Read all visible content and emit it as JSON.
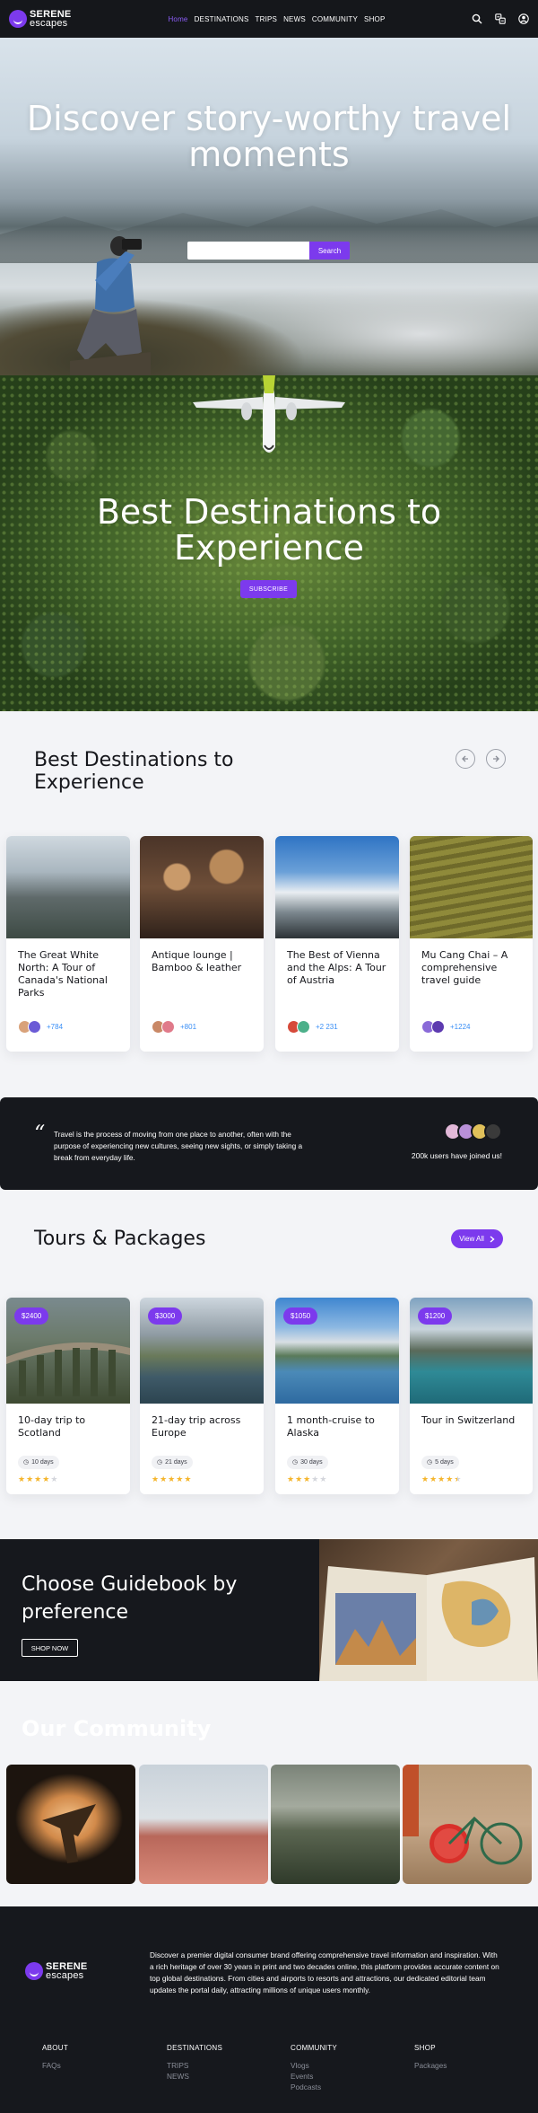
{
  "brand": {
    "name_line1": "SERENE",
    "name_line2": "escapes"
  },
  "nav": {
    "items": [
      "Home",
      "DESTINATIONS",
      "TRIPS",
      "NEWS",
      "COMMUNITY",
      "SHOP"
    ],
    "active": "Home",
    "icons": [
      "search-icon",
      "translate-icon",
      "user-icon"
    ]
  },
  "hero": {
    "title": "Discover story-worthy travel moments",
    "search_placeholder": "",
    "search_button": "Search"
  },
  "banner": {
    "title": "Best Destinations to Experience",
    "subscribe_button": "SUBSCRIBE"
  },
  "destinations": {
    "title": "Best Destinations to Experience",
    "cards": [
      {
        "title": "The Great White North: A Tour of Canada's National Parks",
        "count": "+784"
      },
      {
        "title": "Antique lounge | Bamboo & leather",
        "count": "+801"
      },
      {
        "title": "The Best of Vienna and the Alps: A Tour of Austria",
        "count": "+2 231"
      },
      {
        "title": "Mu Cang Chai – A comprehensive travel guide",
        "count": "+1224"
      }
    ]
  },
  "quote": {
    "text": "Travel is the process of moving from one place to another, often with the purpose of experiencing new cultures, seeing new sights, or simply taking a break from everyday life.",
    "joined": "200k users have joined us!"
  },
  "tours": {
    "title": "Tours & Packages",
    "view_all": "View All",
    "cards": [
      {
        "price": "$2400",
        "title": "10-day trip to Scotland",
        "days": "10 days",
        "rating": 4
      },
      {
        "price": "$3000",
        "title": "21-day trip across Europe",
        "days": "21 days",
        "rating": 5
      },
      {
        "price": "$1050",
        "title": "1 month-cruise to Alaska",
        "days": "30 days",
        "rating": 3
      },
      {
        "price": "$1200",
        "title": "Tour in Switzerland",
        "days": "5 days",
        "rating": 4.5
      }
    ]
  },
  "guidebook": {
    "title": "Choose Guidebook by preference",
    "button": "SHOP NOW"
  },
  "community": {
    "title": "Our Community"
  },
  "footer": {
    "description": "Discover a premier digital consumer brand offering comprehensive travel information and inspiration. With a rich heritage of over 30 years in print and two decades online, this platform provides accurate content on top global destinations. From cities and airports to resorts and attractions, our dedicated editorial team updates the portal daily, attracting millions of unique users monthly.",
    "columns": [
      {
        "heading": "ABOUT",
        "links": [
          "FAQs"
        ]
      },
      {
        "heading": "DESTINATIONS",
        "links": [
          "TRIPS",
          "NEWS"
        ]
      },
      {
        "heading": "COMMUNITY",
        "links": [
          "Vlogs",
          "Events",
          "Podcasts"
        ]
      },
      {
        "heading": "SHOP",
        "links": [
          "Packages"
        ]
      }
    ]
  },
  "colors": {
    "accent": "#7c3aed",
    "dark": "#16181d",
    "link_blue": "#3a8ff6",
    "star": "#f5b52b"
  }
}
